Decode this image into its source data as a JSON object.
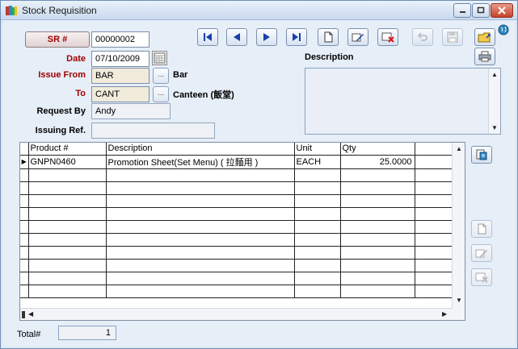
{
  "window": {
    "title": "Stock Requisition",
    "icon": "books-app-icon"
  },
  "header": {
    "sr_button_label": "SR #",
    "sr_number": "00000002",
    "date_label": "Date",
    "date_value": "07/10/2009",
    "issue_from_label": "Issue From",
    "issue_from_code": "BAR",
    "issue_from_name": "Bar",
    "to_label": "To",
    "to_code": "CANT",
    "to_name": "Canteen (飯堂)",
    "request_by_label": "Request By",
    "request_by_value": "Andy",
    "issuing_ref_label": "Issuing Ref.",
    "issuing_ref_value": "",
    "lookup_label": "...",
    "description_label": "Description",
    "description_value": ""
  },
  "toolbar": {
    "buttons": [
      "first-record",
      "previous-record",
      "next-record",
      "last-record",
      "new",
      "edit",
      "delete",
      "undo",
      "save",
      "exit"
    ]
  },
  "grid": {
    "columns": [
      "Product #",
      "Description",
      "Unit",
      "Qty",
      ""
    ],
    "rows": [
      [
        "GNPN0460",
        "Promotion Sheet(Set Menu) ( 拉麵用 )",
        "EACH",
        "25.0000",
        ""
      ]
    ],
    "empty_row_count": 10
  },
  "footer": {
    "total_label": "Total#",
    "total_value": "1"
  },
  "colors": {
    "label_red": "#a00000",
    "window_bg": "#e6eef8",
    "nav_blue": "#1a3fa8"
  }
}
